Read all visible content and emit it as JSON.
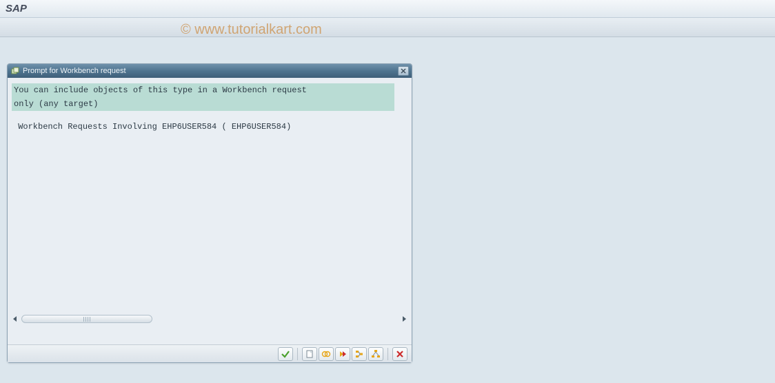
{
  "header": {
    "title": "SAP"
  },
  "watermark": "© www.tutorialkart.com",
  "dialog": {
    "title": "Prompt for Workbench request",
    "highlight_line1": "You can include objects of this type in a Workbench request",
    "highlight_line2": "only (any target)",
    "info_line": " Workbench Requests Involving EHP6USER584 ( EHP6USER584)"
  },
  "icons": {
    "dialog_title_icon": "overlap-squares-icon",
    "close": "close-icon",
    "check": "check-icon",
    "new_doc": "new-document-icon",
    "own": "own-requests-icon",
    "forward": "forward-icon",
    "tree1": "tree-icon",
    "tree2": "tree-alt-icon",
    "cancel": "cancel-icon"
  },
  "colors": {
    "accent_green": "#4aa02c",
    "accent_red": "#cc2b2b",
    "accent_yellow": "#e7a618",
    "titlebar_grad_top": "#6f91ab",
    "titlebar_grad_bot": "#3e5f79"
  }
}
